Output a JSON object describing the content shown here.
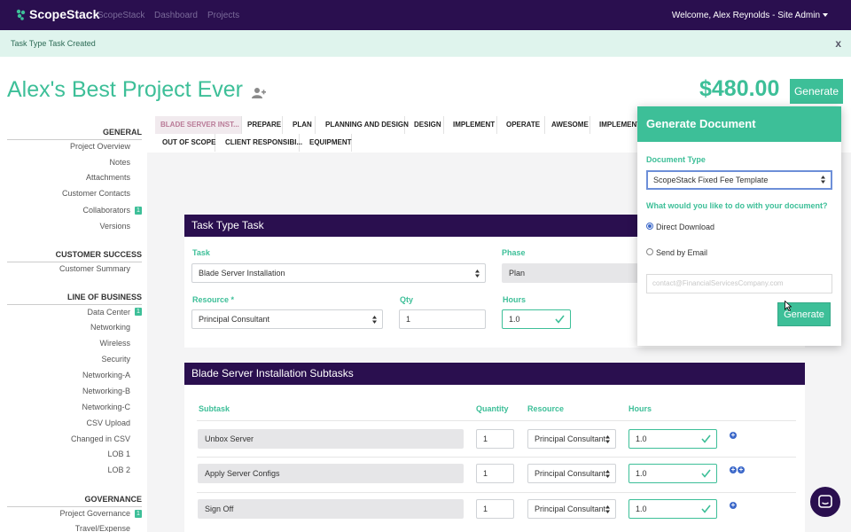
{
  "nav": {
    "brand": "ScopeStack",
    "links": [
      "ScopeStack",
      "Dashboard",
      "Projects"
    ],
    "welcome": "Welcome, Alex Reynolds - Site Admin"
  },
  "alert": {
    "message": "Task Type Task Created",
    "close": "x"
  },
  "project": {
    "title": "Alex's Best Project Ever",
    "price": "$480.00",
    "generate_label": "Generate"
  },
  "sidebar": {
    "general_heading": "GENERAL",
    "general": [
      "Project Overview",
      "Notes",
      "Attachments",
      "Customer Contacts",
      "Collaborators",
      "Versions"
    ],
    "collaborators_badge": "1",
    "customer_success_heading": "CUSTOMER SUCCESS",
    "customer_success": [
      "Customer Summary"
    ],
    "lob_heading": "LINE OF BUSINESS",
    "lob": [
      "Data Center",
      "Networking",
      "Wireless",
      "Security",
      "Networking-A",
      "Networking-B",
      "Networking-C",
      "CSV Upload",
      "Changed in CSV",
      "LOB 1",
      "LOB 2"
    ],
    "datacenter_badge": "1",
    "governance_heading": "GOVERNANCE",
    "governance": [
      "Project Governance",
      "Travel/Expense"
    ],
    "governance_badge": "1"
  },
  "tabs": {
    "row1": [
      "BLADE SERVER INST...",
      "PREPARE",
      "PLAN",
      "PLANNING AND DESIGN",
      "DESIGN",
      "IMPLEMENT",
      "OPERATE",
      "AWESOME",
      "IMPLEMENT-"
    ],
    "row2": [
      "OUT OF SCOPE",
      "CLIENT RESPONSIBI...",
      "EQUIPMENT"
    ]
  },
  "task_form": {
    "title": "Task Type Task",
    "task_label": "Task",
    "task_value": "Blade Server Installation",
    "phase_label": "Phase",
    "phase_value": "Plan",
    "resource_label": "Resource *",
    "resource_value": "Principal Consultant",
    "qty_label": "Qty",
    "qty_value": "1",
    "hours_label": "Hours",
    "hours_value": "1.0"
  },
  "subtasks": {
    "title": "Blade Server Installation Subtasks",
    "headers": [
      "Subtask",
      "Quantity",
      "Resource",
      "Hours"
    ],
    "rows": [
      {
        "name": "Unbox Server",
        "qty": "1",
        "resource": "Principal Consultant",
        "hours": "1.0"
      },
      {
        "name": "Apply Server Configs",
        "qty": "1",
        "resource": "Principal Consultant",
        "hours": "1.0"
      },
      {
        "name": "Sign Off",
        "qty": "1",
        "resource": "Principal Consultant",
        "hours": "1.0"
      }
    ]
  },
  "generate_doc": {
    "title": "Generate Document",
    "doc_type_label": "Document Type",
    "doc_type_value": "ScopeStack Fixed Fee Template",
    "question": "What would you like to do with your document?",
    "option_download": "Direct Download",
    "option_email": "Send by Email",
    "email_placeholder": "contact@FinancialServicesCompany.com",
    "button": "Generate"
  },
  "icons": {
    "logo": "scopestack-logo-icon",
    "add_collaborator": "add-user-icon",
    "select": "select-arrows-icon",
    "valid": "checkmark-icon",
    "add_row": "plus-circle-icon",
    "chat": "chat-icon"
  },
  "colors": {
    "brand_purple": "#2a0f4f",
    "accent_green": "#3dbf98",
    "link_blue": "#3c68c9"
  }
}
